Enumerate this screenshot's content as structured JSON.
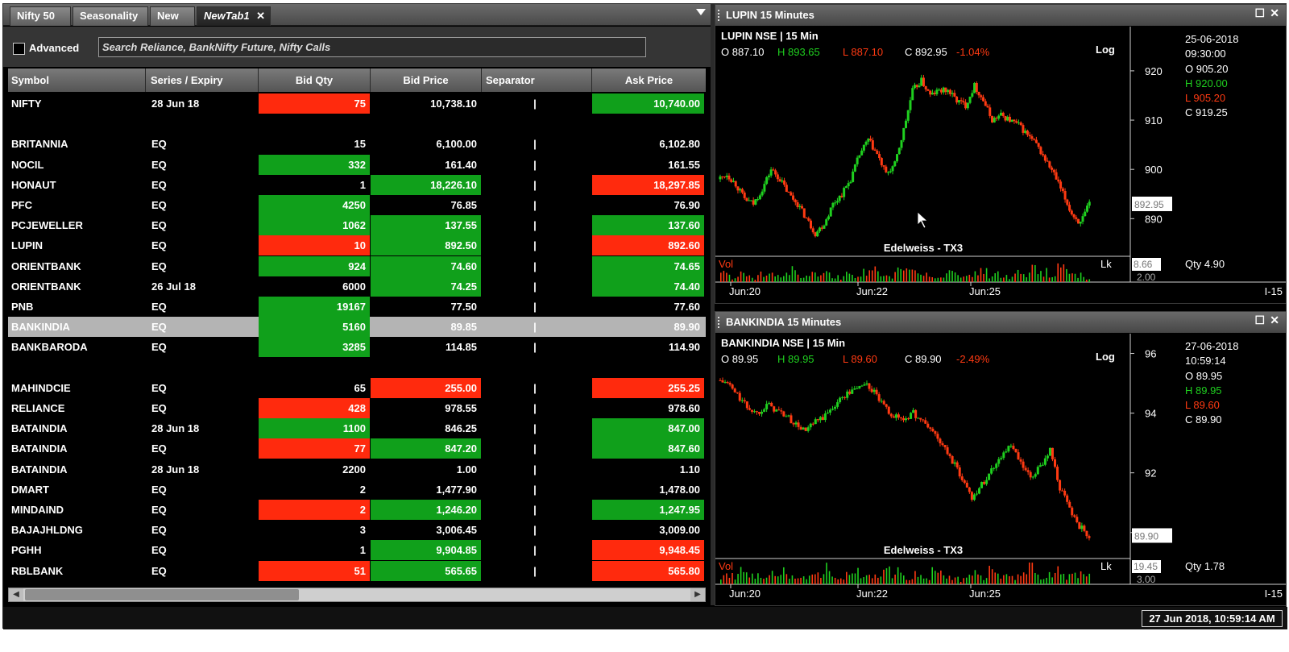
{
  "tabs": [
    {
      "label": "Nifty 50",
      "active": false
    },
    {
      "label": "Seasonality",
      "active": false
    },
    {
      "label": "New",
      "active": false
    },
    {
      "label": "NewTab1",
      "active": true
    }
  ],
  "toolbar": {
    "advanced_label": "Advanced",
    "advanced_checked": false,
    "search_placeholder": "Search Reliance, BankNifty Future, Nifty Calls"
  },
  "grid": {
    "columns": [
      "Symbol",
      "Series / Expiry",
      "Bid Qty",
      "Bid Price",
      "Separator",
      "Ask Price"
    ],
    "rows": [
      {
        "symbol": "NIFTY",
        "series": "28 Jun 18",
        "bid_qty": "75",
        "bid_price": "10,738.10",
        "sep": "|",
        "ask_price": "10,740.00",
        "bq_color": "red",
        "bp_color": "",
        "ap_color": "green"
      },
      {
        "symbol": "",
        "series": "",
        "bid_qty": "",
        "bid_price": "",
        "sep": "",
        "ask_price": "",
        "bq_color": "",
        "bp_color": "",
        "ap_color": ""
      },
      {
        "symbol": "BRITANNIA",
        "series": "EQ",
        "bid_qty": "15",
        "bid_price": "6,100.00",
        "sep": "|",
        "ask_price": "6,102.80",
        "bq_color": "",
        "bp_color": "",
        "ap_color": ""
      },
      {
        "symbol": "NOCIL",
        "series": "EQ",
        "bid_qty": "332",
        "bid_price": "161.40",
        "sep": "|",
        "ask_price": "161.55",
        "bq_color": "green",
        "bp_color": "",
        "ap_color": ""
      },
      {
        "symbol": "HONAUT",
        "series": "EQ",
        "bid_qty": "1",
        "bid_price": "18,226.10",
        "sep": "|",
        "ask_price": "18,297.85",
        "bq_color": "",
        "bp_color": "green",
        "ap_color": "red"
      },
      {
        "symbol": "PFC",
        "series": "EQ",
        "bid_qty": "4250",
        "bid_price": "76.85",
        "sep": "|",
        "ask_price": "76.90",
        "bq_color": "green",
        "bp_color": "",
        "ap_color": ""
      },
      {
        "symbol": "PCJEWELLER",
        "series": "EQ",
        "bid_qty": "1062",
        "bid_price": "137.55",
        "sep": "|",
        "ask_price": "137.60",
        "bq_color": "green",
        "bp_color": "green",
        "ap_color": "green"
      },
      {
        "symbol": "LUPIN",
        "series": "EQ",
        "bid_qty": "10",
        "bid_price": "892.50",
        "sep": "|",
        "ask_price": "892.60",
        "bq_color": "red",
        "bp_color": "green",
        "ap_color": "red"
      },
      {
        "symbol": "ORIENTBANK",
        "series": "EQ",
        "bid_qty": "924",
        "bid_price": "74.60",
        "sep": "|",
        "ask_price": "74.65",
        "bq_color": "green",
        "bp_color": "green",
        "ap_color": "green"
      },
      {
        "symbol": "ORIENTBANK",
        "series": "26 Jul 18",
        "bid_qty": "6000",
        "bid_price": "74.25",
        "sep": "|",
        "ask_price": "74.40",
        "bq_color": "",
        "bp_color": "green",
        "ap_color": "green"
      },
      {
        "symbol": "PNB",
        "series": "EQ",
        "bid_qty": "19167",
        "bid_price": "77.50",
        "sep": "|",
        "ask_price": "77.60",
        "bq_color": "green",
        "bp_color": "",
        "ap_color": ""
      },
      {
        "symbol": "BANKINDIA",
        "series": "EQ",
        "bid_qty": "5160",
        "bid_price": "89.85",
        "sep": "|",
        "ask_price": "89.90",
        "bq_color": "green",
        "bp_color": "",
        "ap_color": "",
        "selected": true
      },
      {
        "symbol": "BANKBARODA",
        "series": "EQ",
        "bid_qty": "3285",
        "bid_price": "114.85",
        "sep": "|",
        "ask_price": "114.90",
        "bq_color": "green",
        "bp_color": "",
        "ap_color": ""
      },
      {
        "symbol": "",
        "series": "",
        "bid_qty": "",
        "bid_price": "",
        "sep": "",
        "ask_price": "",
        "bq_color": "",
        "bp_color": "",
        "ap_color": ""
      },
      {
        "symbol": "MAHINDCIE",
        "series": "EQ",
        "bid_qty": "65",
        "bid_price": "255.00",
        "sep": "|",
        "ask_price": "255.25",
        "bq_color": "",
        "bp_color": "red",
        "ap_color": "red"
      },
      {
        "symbol": "RELIANCE",
        "series": "EQ",
        "bid_qty": "428",
        "bid_price": "978.55",
        "sep": "|",
        "ask_price": "978.60",
        "bq_color": "red",
        "bp_color": "",
        "ap_color": ""
      },
      {
        "symbol": "BATAINDIA",
        "series": "28 Jun 18",
        "bid_qty": "1100",
        "bid_price": "846.25",
        "sep": "|",
        "ask_price": "847.00",
        "bq_color": "green",
        "bp_color": "",
        "ap_color": "green"
      },
      {
        "symbol": "BATAINDIA",
        "series": "EQ",
        "bid_qty": "77",
        "bid_price": "847.20",
        "sep": "|",
        "ask_price": "847.60",
        "bq_color": "red",
        "bp_color": "green",
        "ap_color": "green"
      },
      {
        "symbol": "BATAINDIA",
        "series": "28 Jun 18",
        "bid_qty": "2200",
        "bid_price": "1.00",
        "sep": "|",
        "ask_price": "1.10",
        "bq_color": "",
        "bp_color": "",
        "ap_color": ""
      },
      {
        "symbol": "DMART",
        "series": "EQ",
        "bid_qty": "2",
        "bid_price": "1,477.90",
        "sep": "|",
        "ask_price": "1,478.00",
        "bq_color": "",
        "bp_color": "",
        "ap_color": ""
      },
      {
        "symbol": "MINDAIND",
        "series": "EQ",
        "bid_qty": "2",
        "bid_price": "1,246.20",
        "sep": "|",
        "ask_price": "1,247.95",
        "bq_color": "red",
        "bp_color": "green",
        "ap_color": "green"
      },
      {
        "symbol": "BAJAJHLDNG",
        "series": "EQ",
        "bid_qty": "3",
        "bid_price": "3,006.45",
        "sep": "|",
        "ask_price": "3,009.00",
        "bq_color": "",
        "bp_color": "",
        "ap_color": ""
      },
      {
        "symbol": "PGHH",
        "series": "EQ",
        "bid_qty": "1",
        "bid_price": "9,904.85",
        "sep": "|",
        "ask_price": "9,948.45",
        "bq_color": "",
        "bp_color": "green",
        "ap_color": "red"
      },
      {
        "symbol": "RBLBANK",
        "series": "EQ",
        "bid_qty": "51",
        "bid_price": "565.65",
        "sep": "|",
        "ask_price": "565.80",
        "bq_color": "red",
        "bp_color": "green",
        "ap_color": "red"
      }
    ]
  },
  "colors": {
    "up": "#10a01b",
    "down": "#ff2a0d",
    "candle_up": "#1fd01f",
    "candle_down": "#ff3a12"
  },
  "charts": [
    {
      "id": "lupin",
      "window_title": "LUPIN  15 Minutes",
      "header": "LUPIN NSE | 15 Min",
      "ohlc_inline": {
        "o": "O 887.10",
        "h": "H 893.65",
        "l": "L 887.10",
        "c": "C 892.95",
        "chg": "-1.04%"
      },
      "scale_mode": "Log",
      "y_ticks": [
        "920",
        "910",
        "900",
        "890"
      ],
      "y_range": [
        884,
        928
      ],
      "last_label": "892.95",
      "info": {
        "date": "25-06-2018",
        "time": "09:30:00",
        "o": "O  905.20",
        "h": "H  920.00",
        "l": "L  905.20",
        "c": "C  919.25"
      },
      "watermark": "Edelweiss - TX3",
      "vol_label": "Vol",
      "vol_lk": "Lk",
      "vol_scale_top": "8.66",
      "vol_scale_bottom": "2.00",
      "qty": "Qty 4.90",
      "x_ticks": [
        "Jun:20",
        "Jun:22",
        "Jun:25"
      ],
      "corner": "I-15",
      "chart_data": {
        "type": "candlestick",
        "title": "LUPIN NSE | 15 Min",
        "x": [
          "Jun:20",
          "Jun:22",
          "Jun:25"
        ],
        "close_path": [
          898,
          899,
          897,
          894,
          893,
          896,
          900,
          898,
          895,
          893,
          890,
          887,
          889,
          893,
          895,
          898,
          903,
          906,
          903,
          899,
          901,
          908,
          916,
          918,
          915,
          916,
          916,
          914,
          913,
          917,
          914,
          910,
          911,
          910,
          909,
          907,
          905,
          902,
          899,
          895,
          891,
          889,
          893
        ],
        "volume_path": [
          3,
          2,
          3,
          2,
          4,
          3,
          2,
          3,
          5,
          2,
          3,
          4,
          3,
          2,
          3,
          3,
          4,
          5,
          3,
          2,
          4,
          6,
          5,
          3,
          2,
          3,
          4,
          3,
          2,
          3,
          4,
          3,
          3,
          2,
          4,
          3,
          5,
          4,
          3,
          6,
          4,
          3,
          2
        ]
      }
    },
    {
      "id": "bankindia",
      "window_title": "BANKINDIA  15 Minutes",
      "header": "BANKINDIA NSE | 15 Min",
      "ohlc_inline": {
        "o": "O 89.95",
        "h": "H 89.95",
        "l": "L 89.60",
        "c": "C 89.90",
        "chg": "-2.49%"
      },
      "scale_mode": "Log",
      "y_ticks": [
        "96",
        "94",
        "92",
        "90"
      ],
      "y_range": [
        89.4,
        96.5
      ],
      "last_label": "89.90",
      "info": {
        "date": "27-06-2018",
        "time": "10:59:14",
        "o": "O  89.95",
        "h": "H  89.95",
        "l": "L  89.60",
        "c": "C  89.90"
      },
      "watermark": "Edelweiss - TX3",
      "vol_label": "Vol",
      "vol_lk": "Lk",
      "vol_scale_top": "19.45",
      "vol_scale_bottom": "3.00",
      "qty": "Qty 1.78",
      "x_ticks": [
        "Jun:20",
        "Jun:22",
        "Jun:25"
      ],
      "corner": "I-15",
      "chart_data": {
        "type": "candlestick",
        "title": "BANKINDIA NSE | 15 Min",
        "x": [
          "Jun:20",
          "Jun:22",
          "Jun:25"
        ],
        "close_path": [
          95.1,
          95.0,
          94.6,
          94.2,
          94.0,
          94.3,
          94.1,
          93.9,
          93.6,
          93.4,
          93.7,
          93.9,
          94.3,
          94.6,
          94.8,
          95.0,
          94.7,
          94.2,
          93.9,
          93.8,
          94.0,
          93.7,
          93.4,
          92.9,
          92.4,
          91.8,
          91.2,
          91.6,
          92.1,
          92.6,
          92.9,
          92.3,
          91.8,
          92.2,
          92.8,
          91.5,
          90.8,
          90.2,
          89.9
        ],
        "volume_path": [
          4,
          3,
          5,
          3,
          2,
          4,
          5,
          3,
          4,
          3,
          5,
          6,
          3,
          4,
          5,
          3,
          4,
          6,
          5,
          3,
          4,
          3,
          5,
          4,
          3,
          2,
          4,
          3,
          5,
          4,
          3,
          4,
          6,
          3,
          4,
          5,
          3,
          4,
          3
        ]
      }
    }
  ],
  "status": {
    "clock": "27 Jun 2018, 10:59:14 AM"
  }
}
